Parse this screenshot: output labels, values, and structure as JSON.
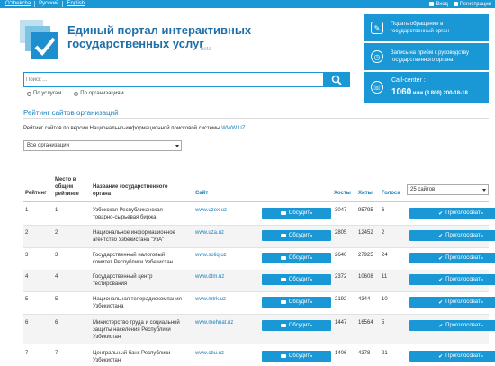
{
  "topbar": {
    "languages": [
      "O'zbekcha",
      "Русский",
      "English"
    ],
    "login": "Вход",
    "register": "Регистрация"
  },
  "brand": {
    "title_line1": "Единый портал интерактивных",
    "title_line2": "государственных услуг",
    "beta": "beta"
  },
  "side_actions": [
    {
      "label_line1": "Подать обращение в",
      "label_line2": "государственный орган"
    },
    {
      "label_line1": "Запись на приём к руководству",
      "label_line2": "государственного органа"
    }
  ],
  "callcenter": {
    "label": "Call-center :",
    "number": "1060",
    "alt": "или (8 800) 200-18-18"
  },
  "search": {
    "placeholder": "Поиск ...",
    "options": [
      "По услугам",
      "По организациям"
    ]
  },
  "page": {
    "heading": "Рейтинг сайтов организаций",
    "description": "Рейтинг сайтов по версии Национально-информационной поисковой системы",
    "description_link": "WWW.UZ",
    "org_filter": "Все организации",
    "per_page": "25 сайтов"
  },
  "table": {
    "headers": {
      "rating": "Рейтинг",
      "place_line1": "Место в",
      "place_line2": "общем",
      "place_line3": "рейтинге",
      "name_line1": "Название государственного",
      "name_line2": "органа",
      "site": "Сайт",
      "hosts": "Хосты",
      "hits": "Хиты",
      "votes": "Голоса"
    },
    "discuss_label": "Обсудить",
    "vote_label": "Проголосовать",
    "rows": [
      {
        "rating": "1",
        "place": "1",
        "name1": "Узбекская Республиканская",
        "name2": "товарно-сырьевая биржа",
        "name3": "",
        "site": "www.uzex.uz",
        "hosts": "3047",
        "hits": "95795",
        "votes": "6"
      },
      {
        "rating": "2",
        "place": "2",
        "name1": "Национальное информационное",
        "name2": "агентство Узбекистана \"УзА\"",
        "name3": "",
        "site": "www.uza.uz",
        "hosts": "2805",
        "hits": "12452",
        "votes": "2"
      },
      {
        "rating": "3",
        "place": "3",
        "name1": "Государственный налоговый",
        "name2": "комитет Республики Узбекистан",
        "name3": "",
        "site": "www.soliq.uz",
        "hosts": "2640",
        "hits": "27925",
        "votes": "24"
      },
      {
        "rating": "4",
        "place": "4",
        "name1": "Государственный центр",
        "name2": "тестирования",
        "name3": "",
        "site": "www.dtm.uz",
        "hosts": "2372",
        "hits": "10608",
        "votes": "11"
      },
      {
        "rating": "5",
        "place": "5",
        "name1": "Национальная телерадиокомпания",
        "name2": "Узбекистана",
        "name3": "",
        "site": "www.mtrk.uz",
        "hosts": "2192",
        "hits": "4344",
        "votes": "10"
      },
      {
        "rating": "6",
        "place": "6",
        "name1": "Министерство труда и социальной",
        "name2": "защиты населения Республики",
        "name3": "Узбекистан",
        "site": "www.mehnat.uz",
        "hosts": "1447",
        "hits": "16564",
        "votes": "5"
      },
      {
        "rating": "7",
        "place": "7",
        "name1": "Центральный банк Республики",
        "name2": "Узбекистан",
        "name3": "",
        "site": "www.cbu.uz",
        "hosts": "1406",
        "hits": "4378",
        "votes": "21"
      }
    ]
  },
  "colors": {
    "primary": "#1a97d5",
    "link": "#1a7fbf",
    "title": "#1f6fa9"
  }
}
